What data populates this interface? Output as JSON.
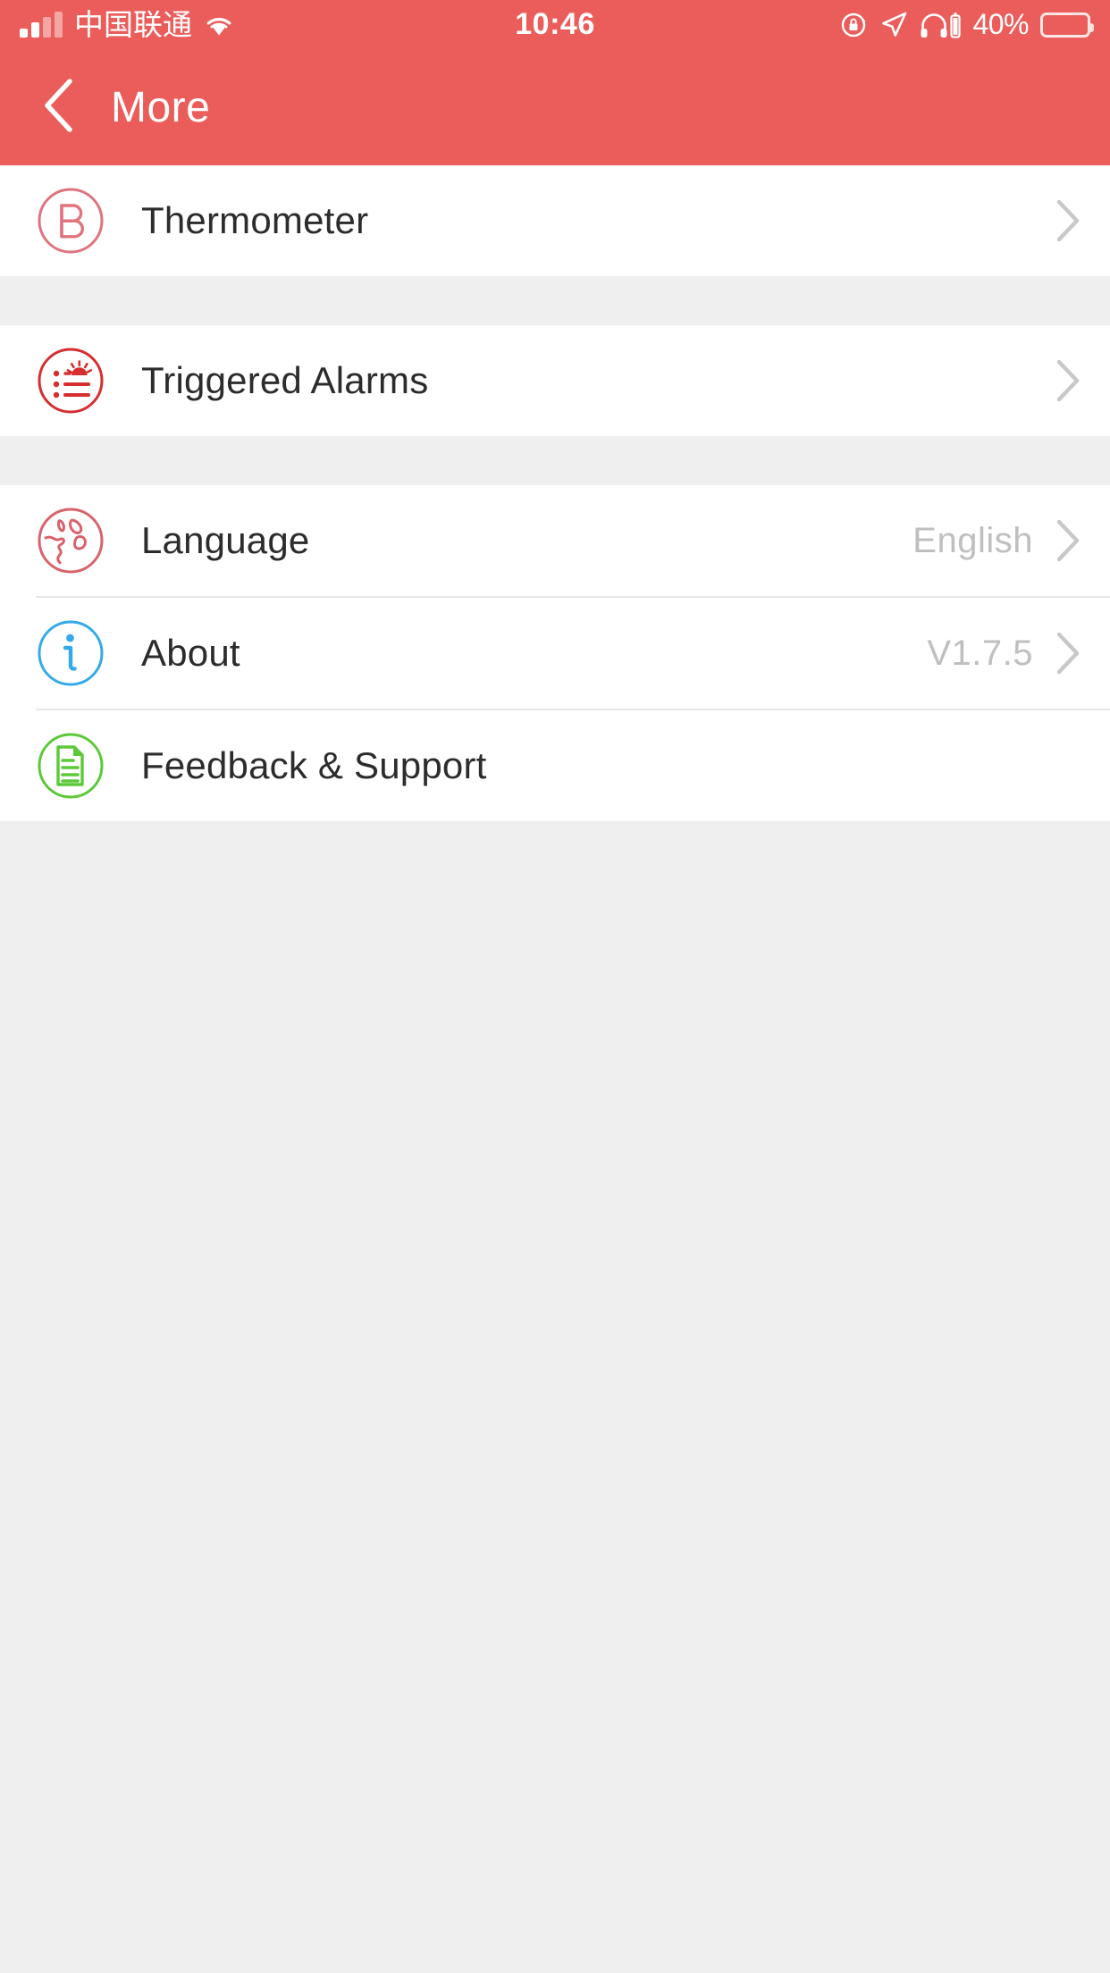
{
  "status_bar": {
    "carrier": "中国联通",
    "time": "10:46",
    "battery_percent": "40%",
    "icons": [
      "signal-bars-icon",
      "wifi-icon",
      "rotation-lock-icon",
      "location-arrow-icon",
      "headphones-icon",
      "battery-icon"
    ]
  },
  "nav": {
    "back_icon": "chevron-left-icon",
    "title": "More"
  },
  "colors": {
    "accent_red": "#EA5D5A",
    "icon_pink": "#E36A73",
    "icon_red": "#D62E2E",
    "icon_blue": "#34AAE8",
    "icon_green": "#5CC939",
    "page_bg": "#EFEFEF",
    "card_bg": "#FFFFFF",
    "label_text": "#2C2C2C",
    "value_text": "#BFBFBF",
    "chevron": "#C8C8C8",
    "divider": "#E6E6E6"
  },
  "sections": [
    {
      "rows": [
        {
          "label": "Thermometer",
          "value": "",
          "icon": "thermometer-b-icon",
          "has_chevron": true
        }
      ]
    },
    {
      "rows": [
        {
          "label": "Triggered Alarms",
          "value": "",
          "icon": "alarm-list-icon",
          "has_chevron": true
        }
      ]
    },
    {
      "rows": [
        {
          "label": "Language",
          "value": "English",
          "icon": "globe-icon",
          "has_chevron": true
        },
        {
          "label": "About",
          "value": "V1.7.5",
          "icon": "info-icon",
          "has_chevron": true
        },
        {
          "label": "Feedback & Support",
          "value": "",
          "icon": "document-icon",
          "has_chevron": false
        }
      ]
    }
  ]
}
